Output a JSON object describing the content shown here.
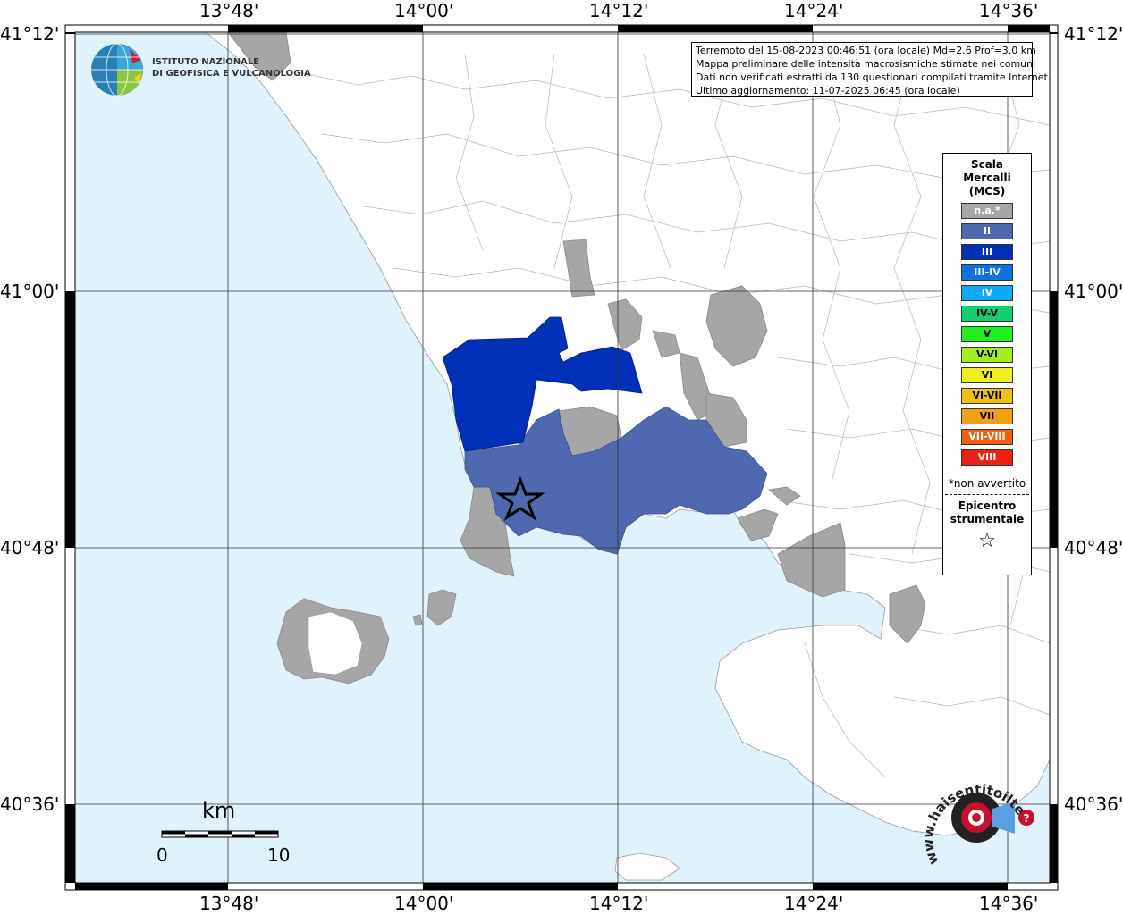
{
  "info_box": {
    "line1": "Terremoto del 15-08-2023 00:46:51 (ora locale) Md=2.6 Prof=3.0 km",
    "line2": "Mappa preliminare delle intensità macrosismiche stimate nei comuni",
    "line3": "Dati non verificati estratti da 130 questionari compilati tramite Internet.",
    "line4": "Ultimo aggiornamento: 11-07-2025 06:45 (ora locale)"
  },
  "logo": {
    "line1": "ISTITUTO NAZIONALE",
    "line2": "DI GEOFISICA E VULCANOLOGIA"
  },
  "lon_labels": [
    "13°48'",
    "14°00'",
    "14°12'",
    "14°24'",
    "14°36'"
  ],
  "lat_labels": [
    "41°12'",
    "41°00'",
    "40°48'",
    "40°36'"
  ],
  "legend": {
    "title1": "Scala",
    "title2": "Mercalli",
    "title3": "(MCS)",
    "items": [
      {
        "label": "n.a.*",
        "color": "#a6a6a6"
      },
      {
        "label": "II",
        "color": "#5068b0"
      },
      {
        "label": "III",
        "color": "#0030b8"
      },
      {
        "label": "III-IV",
        "color": "#1070e0"
      },
      {
        "label": "IV",
        "color": "#10a8f0"
      },
      {
        "label": "IV-V",
        "color": "#10d070"
      },
      {
        "label": "V",
        "color": "#20f020"
      },
      {
        "label": "V-VI",
        "color": "#a0f020"
      },
      {
        "label": "VI",
        "color": "#f0f020"
      },
      {
        "label": "VI-VII",
        "color": "#f0c010"
      },
      {
        "label": "VII",
        "color": "#f0a010"
      },
      {
        "label": "VII-VIII",
        "color": "#f06010"
      },
      {
        "label": "VIII",
        "color": "#f02010"
      }
    ],
    "note": "*non avvertito",
    "epi1": "Epicentro",
    "epi2": "strumentale",
    "epi_symbol": "☆"
  },
  "scale_bar": {
    "unit": "km",
    "start": "0",
    "end": "10"
  },
  "watermark": {
    "text": "www.haisentitoilterremoto.it"
  },
  "colors": {
    "sea": "#e0f2fc",
    "land": "#ffffff",
    "na": "#a6a6a6",
    "ii": "#5068b0",
    "iii": "#0030b8"
  }
}
